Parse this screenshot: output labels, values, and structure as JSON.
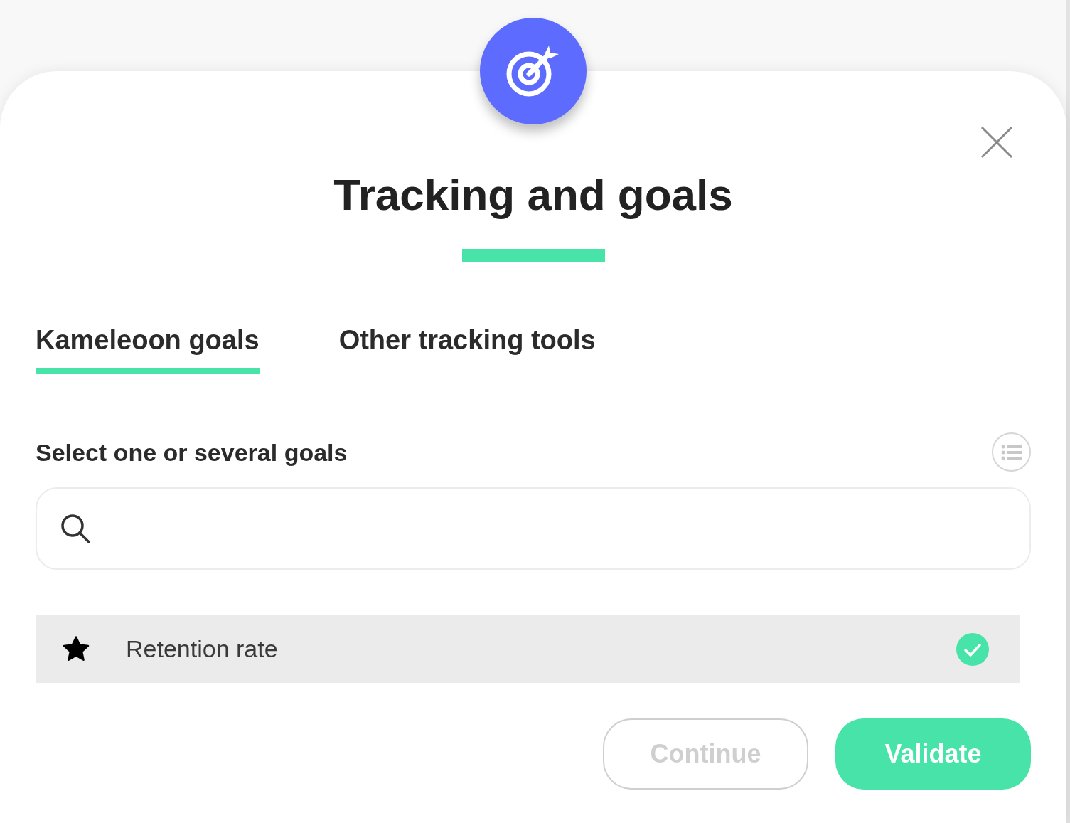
{
  "dialog": {
    "title": "Tracking and goals"
  },
  "tabs": [
    {
      "label": "Kameleoon goals",
      "selected": true
    },
    {
      "label": "Other tracking tools",
      "selected": false
    }
  ],
  "section_label": "Select one or several goals",
  "goals": [
    {
      "name": "Retention rate",
      "starred": true,
      "selected": true
    }
  ],
  "buttons": [
    {
      "label": "Continue",
      "kind": "secondary"
    },
    {
      "label": "Validate",
      "kind": "primary"
    }
  ]
}
